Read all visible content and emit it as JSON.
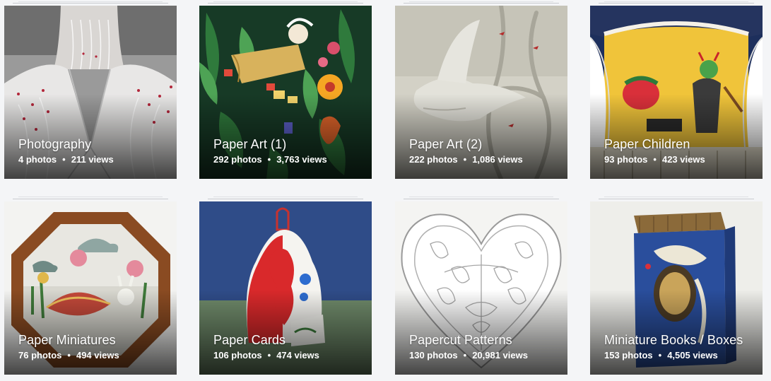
{
  "albums": [
    {
      "title": "Photography",
      "photos": "4 photos",
      "views": "211 views",
      "thumb": "neck-embroidery-photo"
    },
    {
      "title": "Paper Art (1)",
      "photos": "292 photos",
      "views": "3,763 views",
      "thumb": "paper-forest-girl"
    },
    {
      "title": "Paper Art (2)",
      "photos": "222 photos",
      "views": "1,086 views",
      "thumb": "paper-bird-thorns"
    },
    {
      "title": "Paper Children",
      "photos": "93 photos",
      "views": "423 views",
      "thumb": "paper-theater-cricket"
    },
    {
      "title": "Paper Miniatures",
      "photos": "76 photos",
      "views": "494 views",
      "thumb": "octagon-diorama"
    },
    {
      "title": "Paper Cards",
      "photos": "106 photos",
      "views": "474 views",
      "thumb": "bell-card"
    },
    {
      "title": "Papercut Patterns",
      "photos": "130 photos",
      "views": "20,981 views",
      "thumb": "heart-pattern"
    },
    {
      "title": "Miniature Books / Boxes",
      "photos": "153 photos",
      "views": "4,505 views",
      "thumb": "blue-book-box"
    }
  ],
  "separator": "•"
}
